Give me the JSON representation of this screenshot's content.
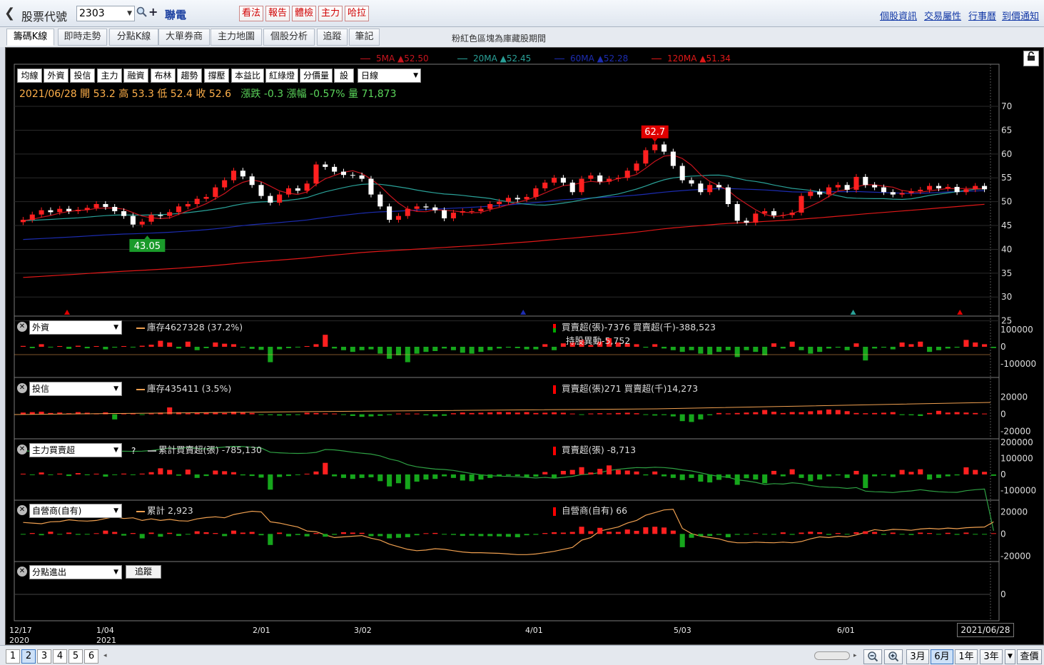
{
  "header": {
    "stock_label": "股票代號",
    "stock_code": "2303",
    "stock_name": "聯電",
    "action_buttons": [
      "看法",
      "報告",
      "體檢",
      "主力",
      "哈拉"
    ],
    "links": [
      "個股資訊",
      "交易屬性",
      "行事曆",
      "到價通知"
    ]
  },
  "tabs": {
    "items": [
      "籌碼K線",
      "即時走勢",
      "分點K線",
      "大單券商",
      "主力地圖",
      "個股分析",
      "追蹤",
      "筆記"
    ],
    "active": "籌碼K線",
    "note": "粉紅色區塊為庫藏股期間"
  },
  "ma_legend": [
    {
      "label": "5MA ▲52.50",
      "color": "#c8141e"
    },
    {
      "label": "20MA ▲52.45",
      "color": "#2aa198"
    },
    {
      "label": "60MA ▲52.28",
      "color": "#1c2cb0"
    },
    {
      "label": "120MA ▲51.34",
      "color": "#e01818"
    }
  ],
  "indicator_buttons": [
    "均線",
    "外資",
    "投信",
    "主力",
    "融資",
    "布林",
    "趨勢",
    "撐壓",
    "本益比",
    "紅綠燈",
    "分價量",
    "設"
  ],
  "period": "日線",
  "ohlc": {
    "date": "2021/06/28",
    "open": "開 53.2",
    "high": "高 53.3",
    "low": "低 52.4",
    "close": "收 52.6",
    "change": "漲跌 -0.3",
    "change_pct": "漲幅 -0.57%",
    "volume": "量 71,873"
  },
  "price_axis": [
    "70",
    "65",
    "60",
    "55",
    "50",
    "45",
    "40",
    "35",
    "30",
    "25"
  ],
  "price_high_marker": "62.7",
  "price_low_marker": "43.05",
  "panels": {
    "foreign": {
      "select": "外資",
      "legend": "庫存4627328 (37.2%)",
      "stats1": "買賣超(張)-7376 買賣超(千)-388,523",
      "stats2": "持股異動-5,752",
      "axis": [
        "100000",
        "0",
        "-100000"
      ]
    },
    "trust": {
      "select": "投信",
      "legend": "庫存435411 (3.5%)",
      "stats1": "買賣超(張)271 買賣超(千)14,273",
      "axis": [
        "20000",
        "0",
        "-20000"
      ]
    },
    "main": {
      "select": "主力買賣超",
      "help": "?",
      "legend": "累計買賣超(張) -785,130",
      "stats1": "買賣超(張) -8,713",
      "axis": [
        "200000",
        "100000",
        "0",
        "-100000"
      ]
    },
    "dealer": {
      "select": "自營商(自有)",
      "legend": "累計 2,923",
      "stats1": "自營商(自有) 66",
      "axis": [
        "20000",
        "0",
        "-20000"
      ]
    },
    "branch": {
      "select": "分點進出",
      "button": "追蹤",
      "axis": [
        "0"
      ]
    }
  },
  "date_axis": [
    {
      "label": "12/17",
      "sub": "2020"
    },
    {
      "label": "1/04",
      "sub": "2021"
    },
    {
      "label": "2/01",
      "sub": ""
    },
    {
      "label": "3/02",
      "sub": ""
    },
    {
      "label": "4/01",
      "sub": ""
    },
    {
      "label": "5/03",
      "sub": ""
    },
    {
      "label": "6/01",
      "sub": ""
    }
  ],
  "last_date": "2021/06/28",
  "footer": {
    "pages": [
      "1",
      "2",
      "3",
      "4",
      "5",
      "6"
    ],
    "active_page": "2",
    "ranges": [
      "3月",
      "6月",
      "1年",
      "3年"
    ],
    "active_range": "6月",
    "query": "查價"
  },
  "chart_data": {
    "type": "candlestick",
    "ylim": [
      23,
      73
    ],
    "closes": [
      46.2,
      47.3,
      48.2,
      47.8,
      48.5,
      48.0,
      48.3,
      48.7,
      49.5,
      48.9,
      48.0,
      47.0,
      45.2,
      45.8,
      47.2,
      47.0,
      47.8,
      49.0,
      49.5,
      50.6,
      51.0,
      53.0,
      54.5,
      56.5,
      55.3,
      53.5,
      51.2,
      49.8,
      51.5,
      52.8,
      52.3,
      53.8,
      57.8,
      57.3,
      56.3,
      55.6,
      55.5,
      54.8,
      51.5,
      49.0,
      46.2,
      47.0,
      48.5,
      49.0,
      48.8,
      48.2,
      46.5,
      47.7,
      48.0,
      48.0,
      48.5,
      49.5,
      50.0,
      50.8,
      50.5,
      51.0,
      52.8,
      54.0,
      55.0,
      54.0,
      52.0,
      54.8,
      55.5,
      54.2,
      54.8,
      55.0,
      56.5,
      58.0,
      60.8,
      62.0,
      60.5,
      57.5,
      54.5,
      53.8,
      52.0,
      53.5,
      53.0,
      49.5,
      46.0,
      45.6,
      47.5,
      48.0,
      47.1,
      47.2,
      47.7,
      51.2,
      52.1,
      51.5,
      53.0,
      53.5,
      52.5,
      55.2,
      53.5,
      53.0,
      52.0,
      51.5,
      51.8,
      52.2,
      52.5,
      53.3,
      52.8,
      53.1,
      52.0,
      52.6,
      53.3,
      52.6
    ],
    "foreign": [
      5000,
      -8000,
      15000,
      -3000,
      2000,
      -12000,
      6000,
      -9000,
      3000,
      -15000,
      -5000,
      4000,
      -2000,
      6000,
      12000,
      35000,
      25000,
      -10000,
      30000,
      -20000,
      -8000,
      25000,
      18000,
      15000,
      -5000,
      -12000,
      -18000,
      -90000,
      -15000,
      -8000,
      -3000,
      2000,
      15000,
      70000,
      -10000,
      -20000,
      -30000,
      -20000,
      -15000,
      -40000,
      -70000,
      -50000,
      -90000,
      -40000,
      -30000,
      -25000,
      -10000,
      -20000,
      -35000,
      -40000,
      -30000,
      -20000,
      -10000,
      -5000,
      -8000,
      -15000,
      -15000,
      15000,
      -20000,
      20000,
      25000,
      40000,
      10000,
      30000,
      50000,
      25000,
      20000,
      15000,
      -5000,
      15000,
      -10000,
      -20000,
      -30000,
      -20000,
      -40000,
      -45000,
      -30000,
      -20000,
      -60000,
      -20000,
      -30000,
      -50000,
      20000,
      -10000,
      30000,
      -20000,
      -40000,
      -30000,
      -10000,
      -5000,
      -20000,
      20000,
      -80000,
      -10000,
      -5000,
      -15000,
      25000,
      15000,
      30000,
      -30000,
      -20000,
      -10000,
      -5000,
      40000,
      25000,
      15000,
      -7376
    ],
    "trust": [
      2000,
      2500,
      3000,
      1500,
      2000,
      1200,
      2500,
      1800,
      1000,
      2200,
      -6000,
      1200,
      1000,
      -500,
      800,
      2000,
      8000,
      2400,
      1200,
      1800,
      2200,
      2500,
      1500,
      3000,
      2000,
      1500,
      -800,
      -1000,
      -1500,
      -1200,
      -900,
      1800,
      1500,
      1000,
      800,
      -500,
      -2000,
      -3000,
      -2500,
      -1800,
      -1000,
      800,
      600,
      500,
      -1200,
      -2500,
      -1800,
      1200,
      2000,
      1500,
      1800,
      2200,
      2600,
      2400,
      2000,
      2500,
      1500,
      1800,
      2200,
      1800,
      800,
      -500,
      900,
      1200,
      1000,
      1500,
      1800,
      1200,
      -400,
      -1500,
      -1000,
      -2500,
      -8000,
      -9000,
      -6000,
      -1200,
      1500,
      1000,
      1500,
      2000,
      2400,
      5000,
      3000,
      1500,
      2600,
      2400,
      3500,
      4500,
      5500,
      5000,
      3600,
      1500,
      1200,
      1500,
      1800,
      2500,
      -1000,
      -1200,
      -2000,
      1500,
      4000,
      2000,
      2500,
      2000,
      1500,
      271
    ],
    "main": [
      2000,
      -4000,
      12000,
      -3000,
      5000,
      -10000,
      8000,
      -5000,
      3000,
      -14000,
      -4000,
      5000,
      -3000,
      5000,
      14000,
      38000,
      28000,
      -8000,
      30000,
      -22000,
      -10000,
      24000,
      20000,
      14000,
      -6000,
      -10000,
      -20000,
      -95000,
      -16000,
      -10000,
      -4000,
      4000,
      18000,
      72000,
      -12000,
      -22000,
      -28000,
      -22000,
      -18000,
      -42000,
      -75000,
      -55000,
      -92000,
      -45000,
      -32000,
      -28000,
      -12000,
      -22000,
      -38000,
      -42000,
      -32000,
      -22000,
      -12000,
      -8000,
      -10000,
      -16000,
      -14000,
      15000,
      -22000,
      22000,
      28000,
      45000,
      12000,
      35000,
      56000,
      28000,
      24000,
      18000,
      -6000,
      18000,
      -12000,
      -22000,
      -35000,
      -22000,
      -45000,
      -50000,
      -34000,
      -22000,
      -65000,
      -24000,
      -32000,
      -55000,
      22000,
      -12000,
      32000,
      -22000,
      -42000,
      -32000,
      -12000,
      -6000,
      -22000,
      22000,
      -85000,
      -12000,
      -6000,
      -16000,
      28000,
      16000,
      32000,
      -32000,
      -22000,
      -12000,
      -6000,
      44000,
      28000,
      16000,
      -8713
    ],
    "main_cum": [
      -18000,
      -20000,
      -15000,
      -16000,
      -14000,
      -18000,
      -14000,
      -16000,
      -14000,
      -20000,
      -22000,
      -20000,
      -22000,
      -20000,
      -14000,
      -2000,
      8000,
      4000,
      16000,
      6000,
      2000,
      12000,
      20000,
      26000,
      24000,
      18000,
      10000,
      -30000,
      -36000,
      -40000,
      -42000,
      -40000,
      -32000,
      -4000,
      -8000,
      -18000,
      -30000,
      -40000,
      -48000,
      -65000,
      -95000,
      -115000,
      -150000,
      -170000,
      -182000,
      -192000,
      -196000,
      -205000,
      -220000,
      -235000,
      -248000,
      -256000,
      -260000,
      -263000,
      -266000,
      -272000,
      -278000,
      -272000,
      -280000,
      -272000,
      -262000,
      -245000,
      -240000,
      -226000,
      -205000,
      -194000,
      -185000,
      -178000,
      -180000,
      -174000,
      -178000,
      -186000,
      -200000,
      -210000,
      -228000,
      -248000,
      -262000,
      -270000,
      -296000,
      -306000,
      -320000,
      -340000,
      -332000,
      -336000,
      -324000,
      -332000,
      -350000,
      -362000,
      -367000,
      -369000,
      -378000,
      -370000,
      -404000,
      -410000,
      -412000,
      -418000,
      -408000,
      -402000,
      -390000,
      -402000,
      -410000,
      -414000,
      -416000,
      -400000,
      -390000,
      -384000,
      -785130
    ],
    "dealer": [
      -500,
      800,
      -1200,
      2000,
      -300,
      1200,
      -800,
      -600,
      500,
      3000,
      1800,
      -1500,
      800,
      -4000,
      1200,
      -2500,
      1000,
      -1800,
      -600,
      2400,
      1500,
      800,
      -2000,
      3000,
      1200,
      1800,
      -1200,
      -10000,
      1200,
      -2200,
      -1000,
      -2200,
      800,
      -2500,
      -800,
      1500,
      1200,
      1000,
      -2000,
      -2000,
      -4000,
      -3500,
      -3000,
      -1200,
      500,
      900,
      -500,
      -900,
      -1800,
      -1500,
      -2000,
      -2000,
      -2200,
      -2600,
      -3000,
      -1200,
      -800,
      800,
      1500,
      1200,
      1800,
      6500,
      2500,
      5500,
      2000,
      1800,
      4000,
      2800,
      6000,
      6500,
      5800,
      3000,
      -12000,
      -3500,
      -2000,
      -1800,
      -900,
      -3000,
      -800,
      -600,
      500,
      -400,
      -700,
      1400,
      -800,
      1200,
      2000,
      1500,
      -900,
      800,
      -600,
      1500,
      2400,
      1800,
      -800,
      1200,
      -500,
      -1000,
      1200,
      800,
      -600,
      1000,
      -800,
      1200,
      -500,
      -300,
      66
    ],
    "dealer_cum": [
      2500,
      2000,
      1500,
      3000,
      3200,
      4500,
      3800,
      3500,
      4000,
      5500,
      6800,
      5500,
      6000,
      4000,
      5200,
      4000,
      4800,
      3800,
      3500,
      5200,
      6200,
      6800,
      6000,
      8500,
      9800,
      11000,
      10500,
      3000,
      2000,
      500,
      -1000,
      -4000,
      -4500,
      -7000,
      -9000,
      -8500,
      -8000,
      -7500,
      -9500,
      -11000,
      -14000,
      -16000,
      -18000,
      -19000,
      -18500,
      -17500,
      -18000,
      -19000,
      -20000,
      -20500,
      -20500,
      -20800,
      -21000,
      -21500,
      -22000,
      -22000,
      -21500,
      -20500,
      -19500,
      -18000,
      -16500,
      -11000,
      -9000,
      -4000,
      -2500,
      -1000,
      2000,
      4000,
      8000,
      10000,
      12000,
      12500,
      -2000,
      -6000,
      -8000,
      -9000,
      -10000,
      -12000,
      -13000,
      -13000,
      -12500,
      -12800,
      -13000,
      -12500,
      -13000,
      -12000,
      -10000,
      -8500,
      -9000,
      -8000,
      -8500,
      -7000,
      -5000,
      -3000,
      -3800,
      -2800,
      -3000,
      -3500,
      -2500,
      -2000,
      -2500,
      -1800,
      -2300,
      -1500,
      -1200,
      -1000,
      2923
    ]
  }
}
